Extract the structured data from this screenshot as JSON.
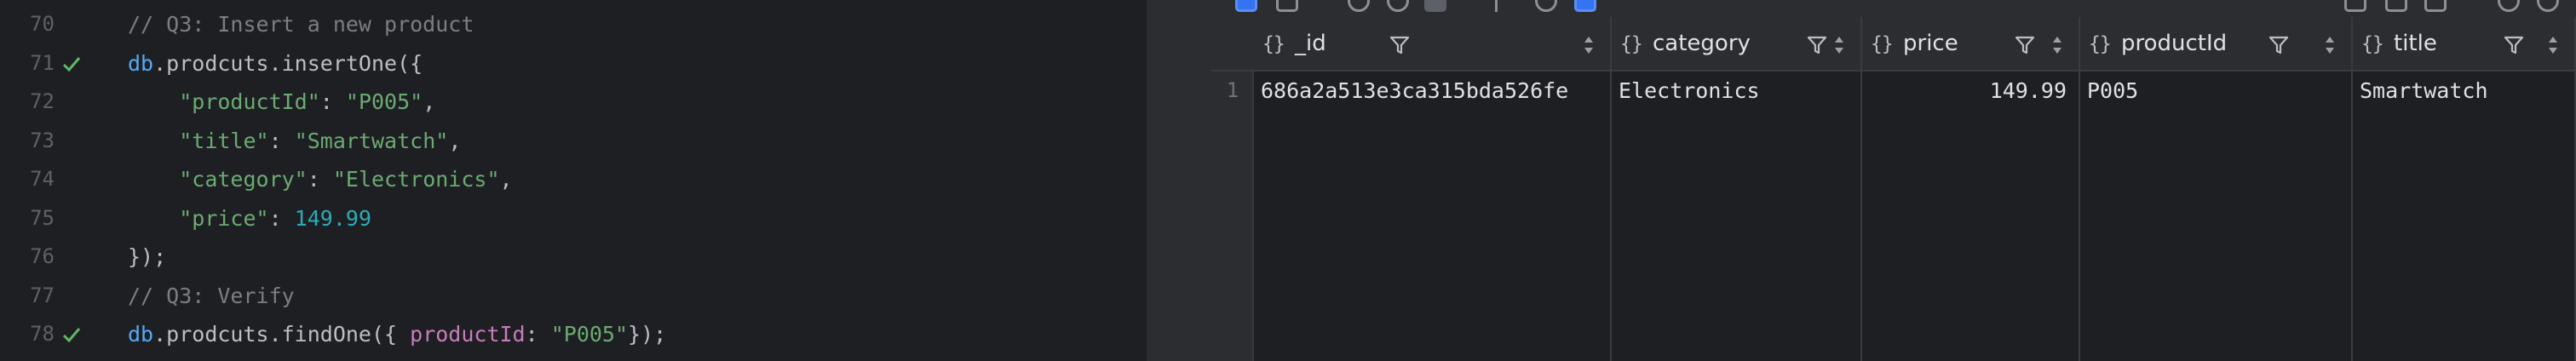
{
  "editor": {
    "lines": [
      {
        "number": "70",
        "checked": false,
        "tokens": [
          {
            "t": "// Q3: Insert a new product",
            "c": "t-comment"
          }
        ]
      },
      {
        "number": "71",
        "checked": true,
        "tokens": [
          {
            "t": "db",
            "c": "t-ident"
          },
          {
            "t": ".prodcuts.insertOne({",
            "c": "t-plain"
          }
        ]
      },
      {
        "number": "72",
        "checked": false,
        "tokens": [
          {
            "t": "    ",
            "c": "t-plain"
          },
          {
            "t": "\"productId\"",
            "c": "t-string"
          },
          {
            "t": ": ",
            "c": "t-plain"
          },
          {
            "t": "\"P005\"",
            "c": "t-string"
          },
          {
            "t": ",",
            "c": "t-plain"
          }
        ]
      },
      {
        "number": "73",
        "checked": false,
        "tokens": [
          {
            "t": "    ",
            "c": "t-plain"
          },
          {
            "t": "\"title\"",
            "c": "t-string"
          },
          {
            "t": ": ",
            "c": "t-plain"
          },
          {
            "t": "\"Smartwatch\"",
            "c": "t-string"
          },
          {
            "t": ",",
            "c": "t-plain"
          }
        ]
      },
      {
        "number": "74",
        "checked": false,
        "tokens": [
          {
            "t": "    ",
            "c": "t-plain"
          },
          {
            "t": "\"category\"",
            "c": "t-string"
          },
          {
            "t": ": ",
            "c": "t-plain"
          },
          {
            "t": "\"Electronics\"",
            "c": "t-string"
          },
          {
            "t": ",",
            "c": "t-plain"
          }
        ]
      },
      {
        "number": "75",
        "checked": false,
        "tokens": [
          {
            "t": "    ",
            "c": "t-plain"
          },
          {
            "t": "\"price\"",
            "c": "t-string"
          },
          {
            "t": ": ",
            "c": "t-plain"
          },
          {
            "t": "149.99",
            "c": "t-number"
          }
        ]
      },
      {
        "number": "76",
        "checked": false,
        "tokens": [
          {
            "t": "});",
            "c": "t-plain"
          }
        ]
      },
      {
        "number": "77",
        "checked": false,
        "tokens": [
          {
            "t": "// Q3: Verify",
            "c": "t-comment"
          }
        ]
      },
      {
        "number": "78",
        "checked": true,
        "tokens": [
          {
            "t": "db",
            "c": "t-ident"
          },
          {
            "t": ".prodcuts.findOne({ ",
            "c": "t-plain"
          },
          {
            "t": "productId",
            "c": "t-field"
          },
          {
            "t": ": ",
            "c": "t-plain"
          },
          {
            "t": "\"P005\"",
            "c": "t-string"
          },
          {
            "t": "});",
            "c": "t-plain"
          }
        ]
      }
    ]
  },
  "results": {
    "object_marker": "{}",
    "columns": [
      {
        "name": "_id"
      },
      {
        "name": "category"
      },
      {
        "name": "price"
      },
      {
        "name": "productId"
      },
      {
        "name": "title"
      }
    ],
    "rows": [
      {
        "row_number": "1",
        "cells": [
          "686a2a513e3ca315bda526fe",
          "Electronics",
          "149.99",
          "P005",
          "Smartwatch"
        ]
      }
    ]
  },
  "colors": {
    "editor_bg": "#1e1f22",
    "panel_bg": "#2b2d30",
    "check_green": "#5fb865",
    "active_icon": "#3574f0"
  },
  "icons": [
    "check-icon",
    "filter-icon",
    "sort-icon",
    "toolbar-icon"
  ]
}
